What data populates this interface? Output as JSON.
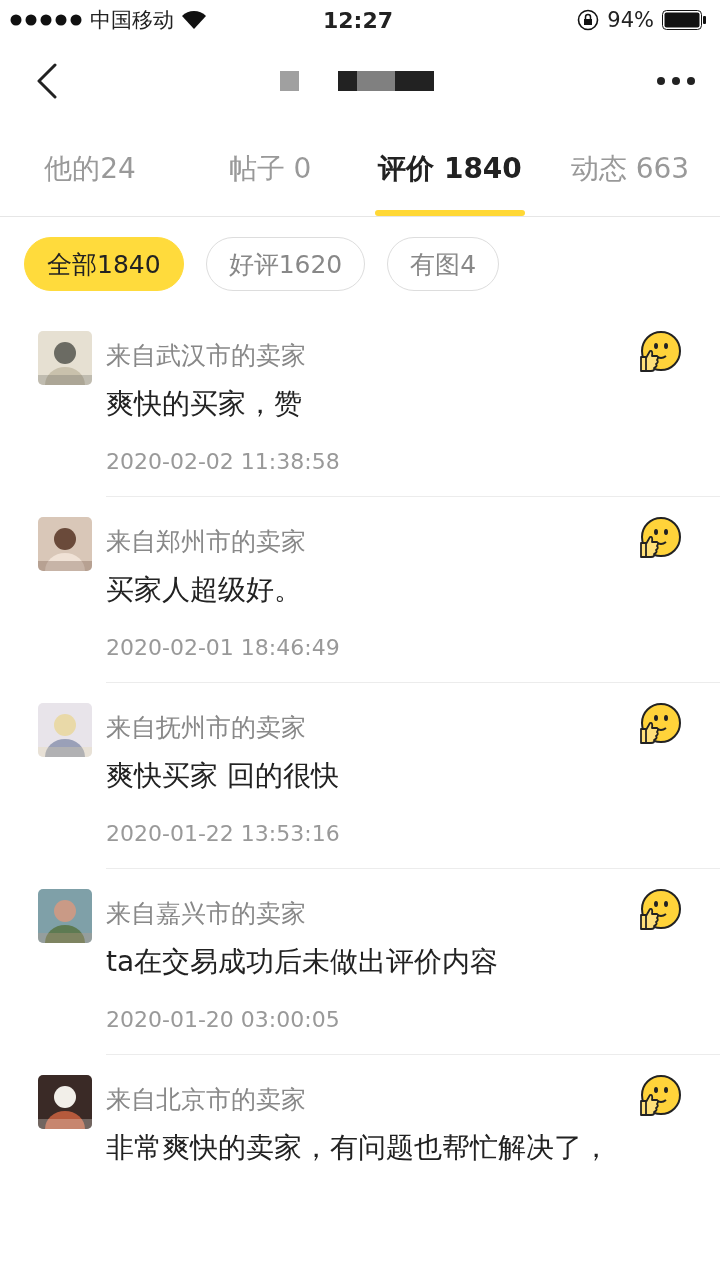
{
  "status_bar": {
    "carrier": "中国移动",
    "time": "12:27",
    "battery": "94%"
  },
  "tabs": [
    {
      "label": "他的24",
      "selected": false
    },
    {
      "label": "帖子 0",
      "selected": false
    },
    {
      "label": "评价 1840",
      "selected": true
    },
    {
      "label": "动态 663",
      "selected": false
    }
  ],
  "filters": [
    {
      "label": "全部1840",
      "selected": true
    },
    {
      "label": "好评1620",
      "selected": false
    },
    {
      "label": "有图4",
      "selected": false
    }
  ],
  "reviews": [
    {
      "source": "来自武汉市的卖家",
      "comment": "爽快的买家，赞",
      "time": "2020-02-02 11:38:58"
    },
    {
      "source": "来自郑州市的卖家",
      "comment": "买家人超级好。",
      "time": "2020-02-01 18:46:49"
    },
    {
      "source": "来自抚州市的卖家",
      "comment": "爽快买家 回的很快",
      "time": "2020-01-22 13:53:16"
    },
    {
      "source": "来自嘉兴市的卖家",
      "comment": "ta在交易成功后未做出评价内容",
      "time": "2020-01-20 03:00:05"
    },
    {
      "source": "来自北京市的卖家",
      "comment": "非常爽快的卖家，有问题也帮忙解决了，"
    }
  ]
}
